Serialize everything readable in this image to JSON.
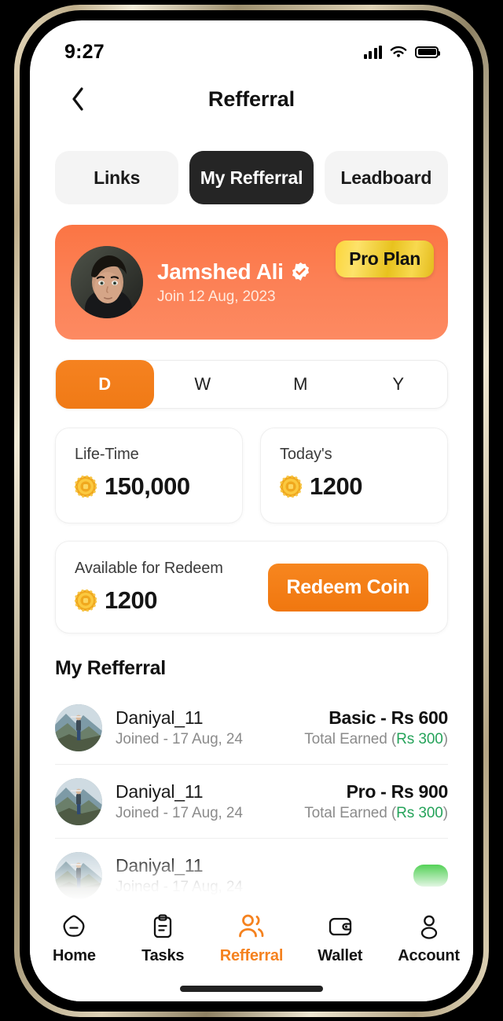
{
  "status_bar": {
    "time": "9:27",
    "cellular_icon": "signal-bars-icon",
    "wifi_icon": "wifi-icon",
    "battery_icon": "battery-full-icon"
  },
  "header": {
    "title": "Refferral",
    "back_icon": "chevron-left-icon"
  },
  "tabs": [
    {
      "label": "Links",
      "active": false
    },
    {
      "label": "My Refferral",
      "active": true
    },
    {
      "label": "Leadboard",
      "active": false
    }
  ],
  "profile": {
    "name": "Jamshed Ali",
    "join_date": "Join 12 Aug, 2023",
    "verified_icon": "verified-badge-icon",
    "avatar_icon": "user-photo",
    "plan_badge": "Pro Plan",
    "card_color": "#fb7544",
    "badge_color": "#f2cd2b"
  },
  "period_selector": {
    "options": [
      {
        "label": "D",
        "active": true
      },
      {
        "label": "W",
        "active": false
      },
      {
        "label": "M",
        "active": false
      },
      {
        "label": "Y",
        "active": false
      }
    ],
    "active_color": "#f58220"
  },
  "stats": [
    {
      "label": "Life-Time",
      "value": "150,000",
      "coin_icon": "coin-icon"
    },
    {
      "label": "Today's",
      "value": "1200",
      "coin_icon": "coin-icon"
    }
  ],
  "redeem": {
    "label": "Available for Redeem",
    "value": "1200",
    "coin_icon": "coin-icon",
    "button_label": "Redeem Coin",
    "button_color": "#f7861f"
  },
  "referral_section": {
    "heading": "My Refferral",
    "rows": [
      {
        "name": "Daniyal_11",
        "joined": "Joined - 17 Aug, 24",
        "plan": "Basic - Rs 600",
        "earned_prefix": "Total Earned (",
        "earned_amount": "Rs 300",
        "earned_suffix": ")",
        "avatar_icon": "user-photo"
      },
      {
        "name": "Daniyal_11",
        "joined": "Joined - 17 Aug, 24",
        "plan": "Pro - Rs 900",
        "earned_prefix": "Total Earned (",
        "earned_amount": "Rs 300",
        "earned_suffix": ")",
        "avatar_icon": "user-photo"
      },
      {
        "name": "Daniyal_11",
        "joined": "Joined - 17 Aug, 24",
        "action_label": "",
        "action_color": "#14bf19",
        "avatar_icon": "user-photo"
      }
    ],
    "earned_color": "#25a35a"
  },
  "bottom_nav": {
    "items": [
      {
        "label": "Home",
        "icon": "home-icon",
        "active": false
      },
      {
        "label": "Tasks",
        "icon": "clipboard-icon",
        "active": false
      },
      {
        "label": "Refferal",
        "icon": "people-icon",
        "active": true
      },
      {
        "label": "Wallet",
        "icon": "wallet-icon",
        "active": false
      },
      {
        "label": "Account",
        "icon": "person-icon",
        "active": false
      }
    ],
    "active_label": "Refferral",
    "active_color": "#f5821f"
  }
}
